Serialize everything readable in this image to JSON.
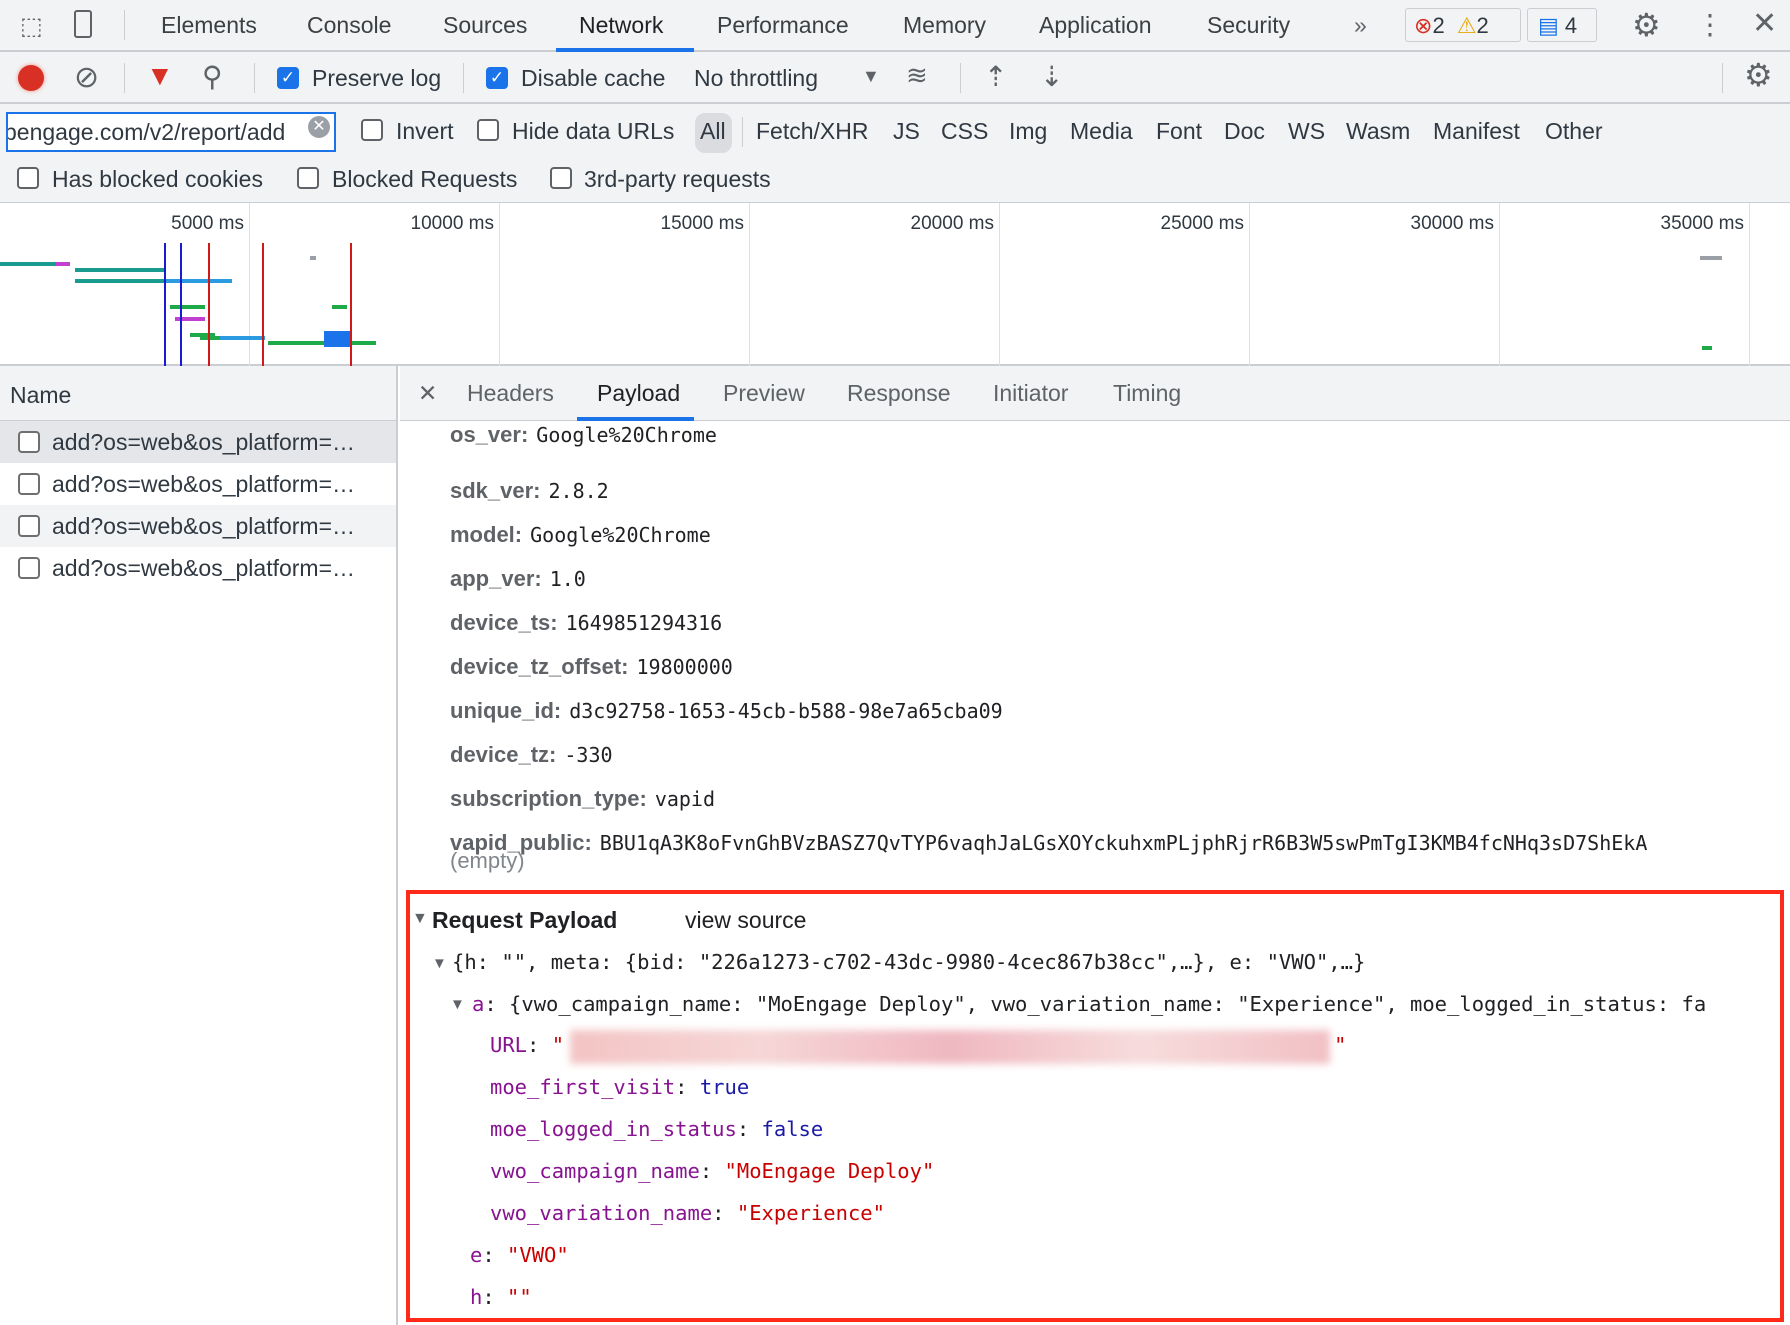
{
  "top_tabs": [
    "Elements",
    "Console",
    "Sources",
    "Network",
    "Performance",
    "Memory",
    "Application",
    "Security"
  ],
  "active_tab": "Network",
  "more_tabs": "»",
  "badges": {
    "errors": "2",
    "warnings": "2",
    "messages": "4"
  },
  "toolbar": {
    "preserve_log": "Preserve log",
    "preserve_log_checked": true,
    "disable_cache": "Disable cache",
    "disable_cache_checked": true,
    "throttling": "No throttling"
  },
  "filter": {
    "value": "pengage.com/v2/report/add",
    "invert": "Invert",
    "hide_data_urls": "Hide data URLs",
    "types": [
      "All",
      "Fetch/XHR",
      "JS",
      "CSS",
      "Img",
      "Media",
      "Font",
      "Doc",
      "WS",
      "Wasm",
      "Manifest",
      "Other"
    ],
    "active_type": "All",
    "has_blocked_cookies": "Has blocked cookies",
    "blocked_requests": "Blocked Requests",
    "third_party": "3rd-party requests"
  },
  "timeline": {
    "ticks": [
      "5000 ms",
      "10000 ms",
      "15000 ms",
      "20000 ms",
      "25000 ms",
      "30000 ms",
      "35000 ms"
    ]
  },
  "requests": {
    "header": "Name",
    "items": [
      "add?os=web&os_platform=…",
      "add?os=web&os_platform=…",
      "add?os=web&os_platform=…",
      "add?os=web&os_platform=…"
    ]
  },
  "detail_tabs": [
    "Headers",
    "Payload",
    "Preview",
    "Response",
    "Initiator",
    "Timing"
  ],
  "active_detail_tab": "Payload",
  "query_params": [
    {
      "k": "os_ver:",
      "v": "Google%20Chrome"
    },
    {
      "k": "sdk_ver:",
      "v": "2.8.2"
    },
    {
      "k": "model:",
      "v": "Google%20Chrome"
    },
    {
      "k": "app_ver:",
      "v": "1.0"
    },
    {
      "k": "device_ts:",
      "v": "1649851294316"
    },
    {
      "k": "device_tz_offset:",
      "v": "19800000"
    },
    {
      "k": "unique_id:",
      "v": "d3c92758-1653-45cb-b588-98e7a65cba09"
    },
    {
      "k": "device_tz:",
      "v": "-330"
    },
    {
      "k": "subscription_type:",
      "v": "vapid"
    },
    {
      "k": "vapid_public:",
      "v": "BBU1qA3K8oFvnGhBVzBASZ7QvTYP6vaqhJaLGsXOYckuhxmPLjphRjrR6B3W5swPmTgI3KMB4fcNHq3sD7ShEkA"
    }
  ],
  "empty_label": "(empty)",
  "payload": {
    "title": "Request Payload",
    "view_source": "view source",
    "summary": "{h: \"\", meta: {bid: \"226a1273-c702-43dc-9980-4cec867b38cc\",…}, e: \"VWO\",…}",
    "a_key": "a",
    "a_summary": "{vwo_campaign_name: \"MoEngage Deploy\", vwo_variation_name: \"Experience\", moe_logged_in_status: fa",
    "fields": [
      {
        "k": "URL",
        "v": "\"",
        "type": "s"
      },
      {
        "k": "moe_first_visit",
        "v": "true",
        "type": "b"
      },
      {
        "k": "moe_logged_in_status",
        "v": "false",
        "type": "b"
      },
      {
        "k": "vwo_campaign_name",
        "v": "\"MoEngage Deploy\"",
        "type": "s"
      },
      {
        "k": "vwo_variation_name",
        "v": "\"Experience\"",
        "type": "s"
      }
    ],
    "e": {
      "k": "e",
      "v": "\"VWO\""
    },
    "h": {
      "k": "h",
      "v": "\"\""
    }
  },
  "colors": {
    "accent": "#1a73e8",
    "record": "#d93025",
    "highlight_box": "#ff2a1a"
  }
}
